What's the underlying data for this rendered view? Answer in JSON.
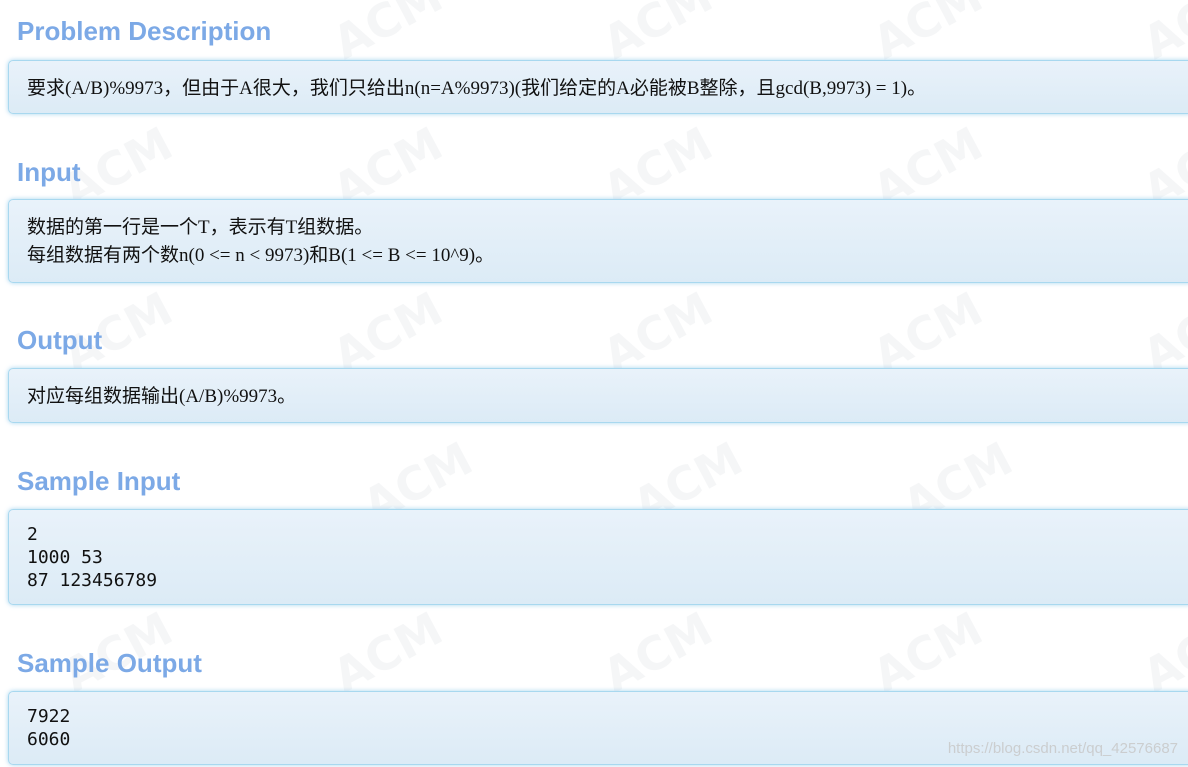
{
  "watermark": {
    "text": "ACM",
    "color": "#c8cdd0"
  },
  "colors": {
    "title": "#7ca9e6",
    "panel_border": "#a8d8ef",
    "panel_bg": "#e3eff8"
  },
  "sections": {
    "problem_description": {
      "title": "Problem Description",
      "lines": [
        "要求(A/B)%9973，但由于A很大，我们只给出n(n=A%9973)(我们给定的A必能被B整除，且gcd(B,9973) = 1)。"
      ]
    },
    "input": {
      "title": "Input",
      "lines": [
        "数据的第一行是一个T，表示有T组数据。",
        "每组数据有两个数n(0 <= n < 9973)和B(1 <= B <= 10^9)。"
      ]
    },
    "output": {
      "title": "Output",
      "lines": [
        "对应每组数据输出(A/B)%9973。"
      ]
    },
    "sample_input": {
      "title": "Sample Input",
      "lines": [
        "2",
        "1000 53",
        "87 123456789"
      ]
    },
    "sample_output": {
      "title": "Sample Output",
      "lines": [
        "7922",
        "6060"
      ]
    }
  },
  "footer": {
    "blog_url": "https://blog.csdn.net/qq_42576687"
  }
}
